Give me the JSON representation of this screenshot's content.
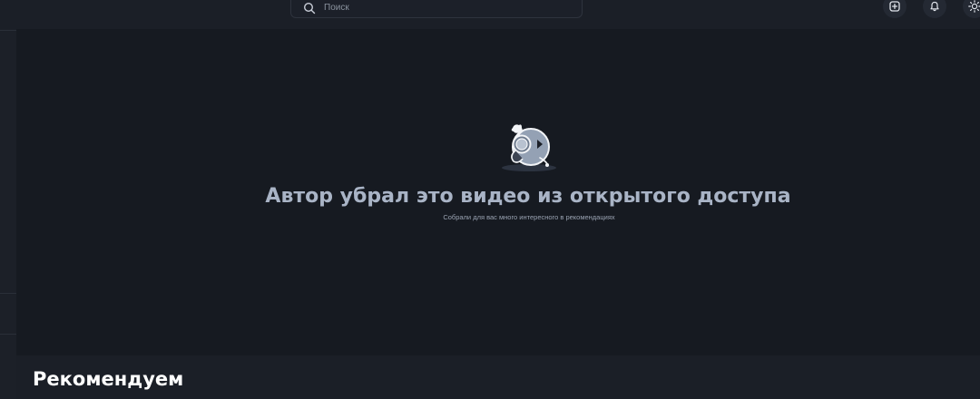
{
  "header": {
    "search": {
      "placeholder": "Поиск",
      "value": ""
    },
    "actions": [
      {
        "icon": "add-video-icon"
      },
      {
        "icon": "bell-icon"
      },
      {
        "icon": "theme-sun-icon"
      }
    ]
  },
  "player": {
    "message_title": "Автор убрал это видео из открытого доступа",
    "message_subtitle": "Собрали для вас много интересного в рекомендациях",
    "illustration_icon": "magnifier-mascot-icon"
  },
  "recommendations": {
    "title": "Рекомендуем"
  },
  "colors": {
    "background": "#1b1f27",
    "player_background": "#161a21",
    "title_text": "#a9b4c6",
    "heading_text": "#ffffff"
  }
}
